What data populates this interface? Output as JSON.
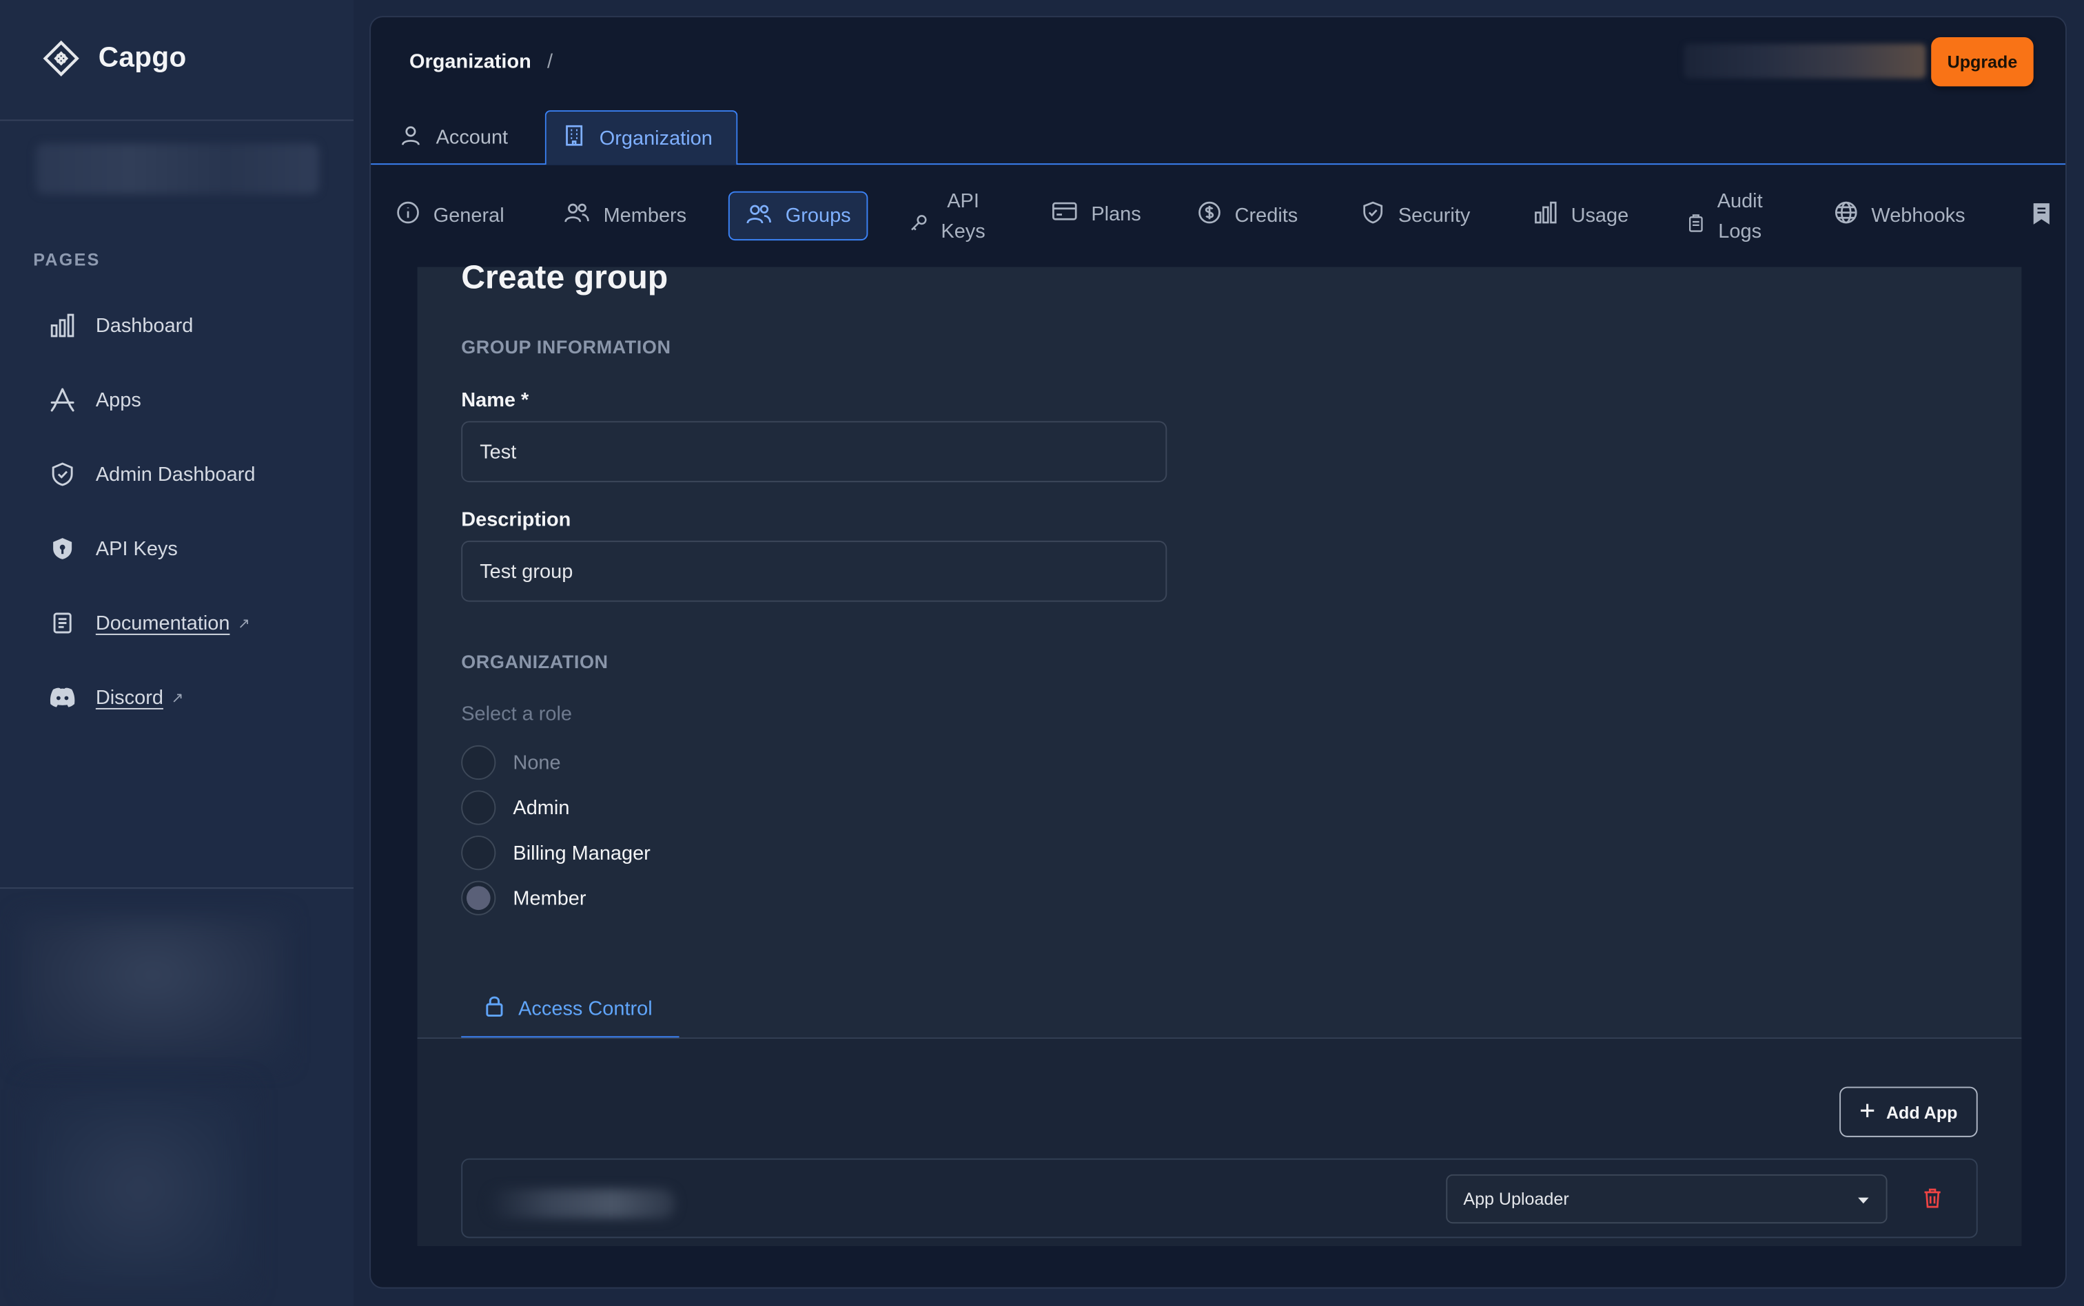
{
  "app": {
    "name": "Capgo"
  },
  "sidebar": {
    "pages_label": "PAGES",
    "items": [
      {
        "label": "Dashboard",
        "icon": "chart-bars-icon"
      },
      {
        "label": "Apps",
        "icon": "app-store-icon"
      },
      {
        "label": "Admin Dashboard",
        "icon": "shield-check-icon"
      },
      {
        "label": "API Keys",
        "icon": "shield-key-icon"
      },
      {
        "label": "Documentation",
        "icon": "document-icon",
        "external": true
      },
      {
        "label": "Discord",
        "icon": "discord-icon",
        "external": true
      }
    ]
  },
  "header": {
    "breadcrumb": "Organization",
    "breadcrumb_sep": "/",
    "upgrade_label": "Upgrade",
    "upgrade_color": "#f97316"
  },
  "top_tabs": [
    {
      "label": "Account",
      "icon": "user-icon",
      "active": false
    },
    {
      "label": "Organization",
      "icon": "building-icon",
      "active": true
    }
  ],
  "sub_tabs": [
    {
      "label": "General",
      "icon": "info-icon"
    },
    {
      "label": "Members",
      "icon": "users-icon"
    },
    {
      "label": "Groups",
      "icon": "users-icon",
      "active": true
    },
    {
      "label_line1": "API",
      "label_line2": "Keys",
      "icon": "key-icon"
    },
    {
      "label": "Plans",
      "icon": "credit-card-icon"
    },
    {
      "label": "Credits",
      "icon": "dollar-icon"
    },
    {
      "label": "Security",
      "icon": "shield-icon"
    },
    {
      "label": "Usage",
      "icon": "chart-bars-icon"
    },
    {
      "label_line1": "Audit",
      "label_line2": "Logs",
      "icon": "clipboard-icon"
    },
    {
      "label": "Webhooks",
      "icon": "globe-icon"
    }
  ],
  "form": {
    "title": "Create group",
    "group_info_label": "GROUP INFORMATION",
    "name_label": "Name *",
    "name_value": "Test",
    "description_label": "Description",
    "description_value": "Test group",
    "org_label": "ORGANIZATION",
    "role_prompt": "Select a role",
    "roles": [
      {
        "label": "None",
        "checked": false
      },
      {
        "label": "Admin",
        "checked": false
      },
      {
        "label": "Billing Manager",
        "checked": false
      },
      {
        "label": "Member",
        "checked": true
      }
    ],
    "access_tab_label": "Access Control",
    "add_app_label": "Add App",
    "app_row": {
      "role_value": "App Uploader"
    }
  },
  "colors": {
    "accent": "#3b82f6",
    "danger": "#ef4444"
  }
}
